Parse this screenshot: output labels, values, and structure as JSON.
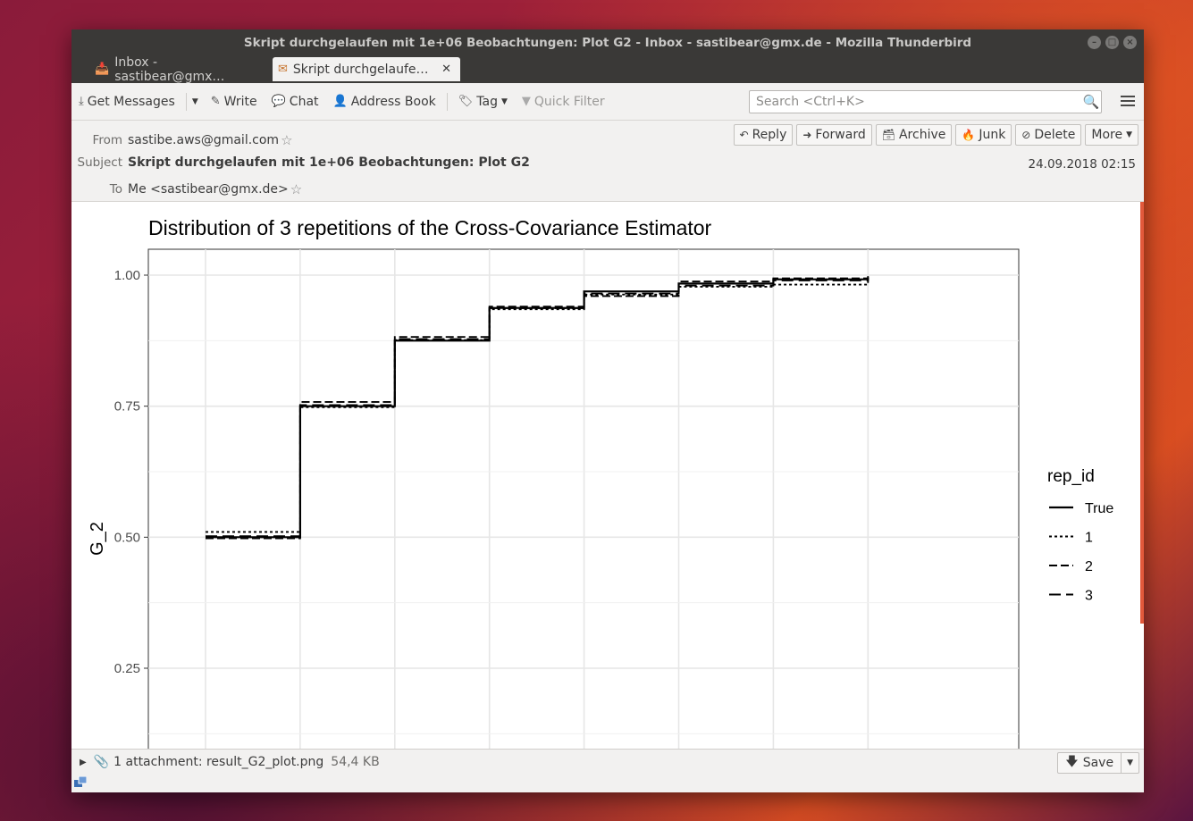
{
  "window": {
    "title": "Skript durchgelaufen mit 1e+06 Beobachtungen: Plot G2 - Inbox - sastibear@gmx.de - Mozilla Thunderbird"
  },
  "tabs": [
    {
      "label": "Inbox - sastibear@gmx…"
    },
    {
      "label": "Skript durchgelaufe…"
    }
  ],
  "toolbar": {
    "get_messages": "Get Messages",
    "write": "Write",
    "chat": "Chat",
    "address_book": "Address Book",
    "tag": "Tag",
    "quick_filter": "Quick Filter",
    "search_placeholder": "Search <Ctrl+K>"
  },
  "header": {
    "from_label": "From",
    "from_value": "sastibe.aws@gmail.com",
    "subject_label": "Subject",
    "subject_value": "Skript durchgelaufen mit 1e+06 Beobachtungen: Plot G2",
    "to_label": "To",
    "to_value": "Me <sastibear@gmx.de>",
    "date": "24.09.2018 02:15",
    "actions": {
      "reply": "Reply",
      "forward": "Forward",
      "archive": "Archive",
      "junk": "Junk",
      "delete": "Delete",
      "more": "More"
    }
  },
  "attachment": {
    "label": "1 attachment: result_G2_plot.png",
    "size": "54,4 KB",
    "save": "Save"
  },
  "chart_data": {
    "type": "line",
    "step": true,
    "title": "Distribution of 3 repetitions of the Cross-Covariance Estimator",
    "xlabel": "",
    "ylabel": "G_2",
    "ylim": [
      0.1,
      1.05
    ],
    "yticks": [
      0.25,
      0.5,
      0.75,
      1.0
    ],
    "ytick_labels": [
      "0.25",
      "0.50",
      "0.75",
      "1.00"
    ],
    "x_positions": [
      1,
      2,
      3,
      4,
      5,
      6,
      7,
      8
    ],
    "grid": true,
    "legend_title": "rep_id",
    "legend_position": "right",
    "series": [
      {
        "name": "True",
        "style": "solid",
        "values": [
          0.5,
          0.75,
          0.875,
          0.9375,
          0.969,
          0.984,
          0.992,
          0.996
        ]
      },
      {
        "name": "1",
        "style": "dotted",
        "values": [
          0.51,
          0.748,
          0.876,
          0.935,
          0.963,
          0.978,
          0.982,
          0.99
        ]
      },
      {
        "name": "2",
        "style": "dashed",
        "values": [
          0.498,
          0.758,
          0.882,
          0.94,
          0.96,
          0.988,
          0.994,
          0.998
        ]
      },
      {
        "name": "3",
        "style": "longdash",
        "values": [
          0.502,
          0.752,
          0.878,
          0.937,
          0.965,
          0.98,
          0.99,
          0.993
        ]
      }
    ]
  }
}
